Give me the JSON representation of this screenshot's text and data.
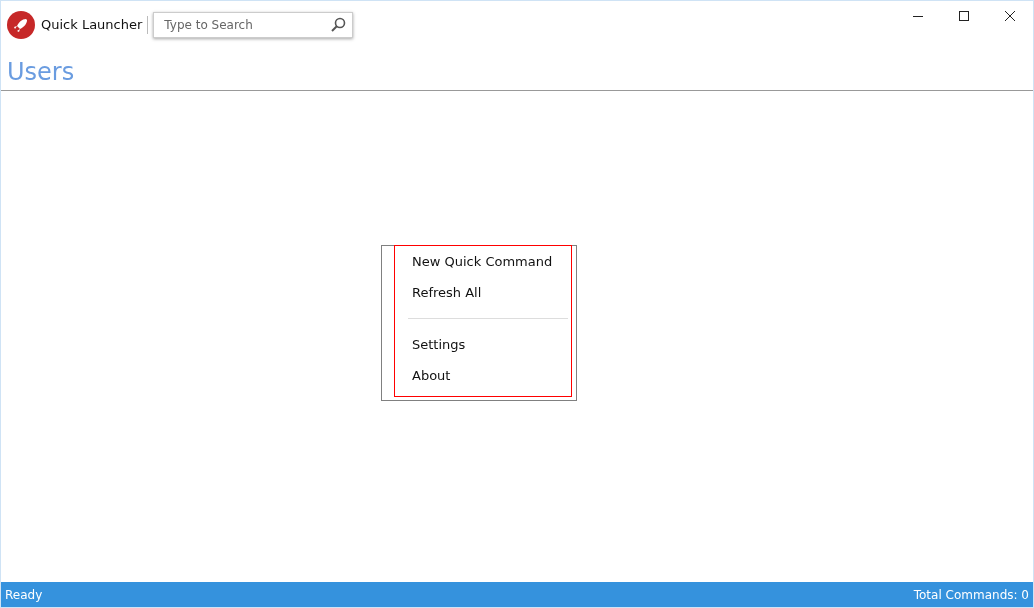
{
  "window": {
    "title": "Quick Launcher"
  },
  "search": {
    "placeholder": "Type to Search"
  },
  "page": {
    "title": "Users"
  },
  "context_menu": {
    "groups": [
      [
        "New Quick Command",
        "Refresh All"
      ],
      [
        "Settings",
        "About"
      ]
    ]
  },
  "status_bar": {
    "left": "Ready",
    "right": "Total Commands: 0"
  }
}
